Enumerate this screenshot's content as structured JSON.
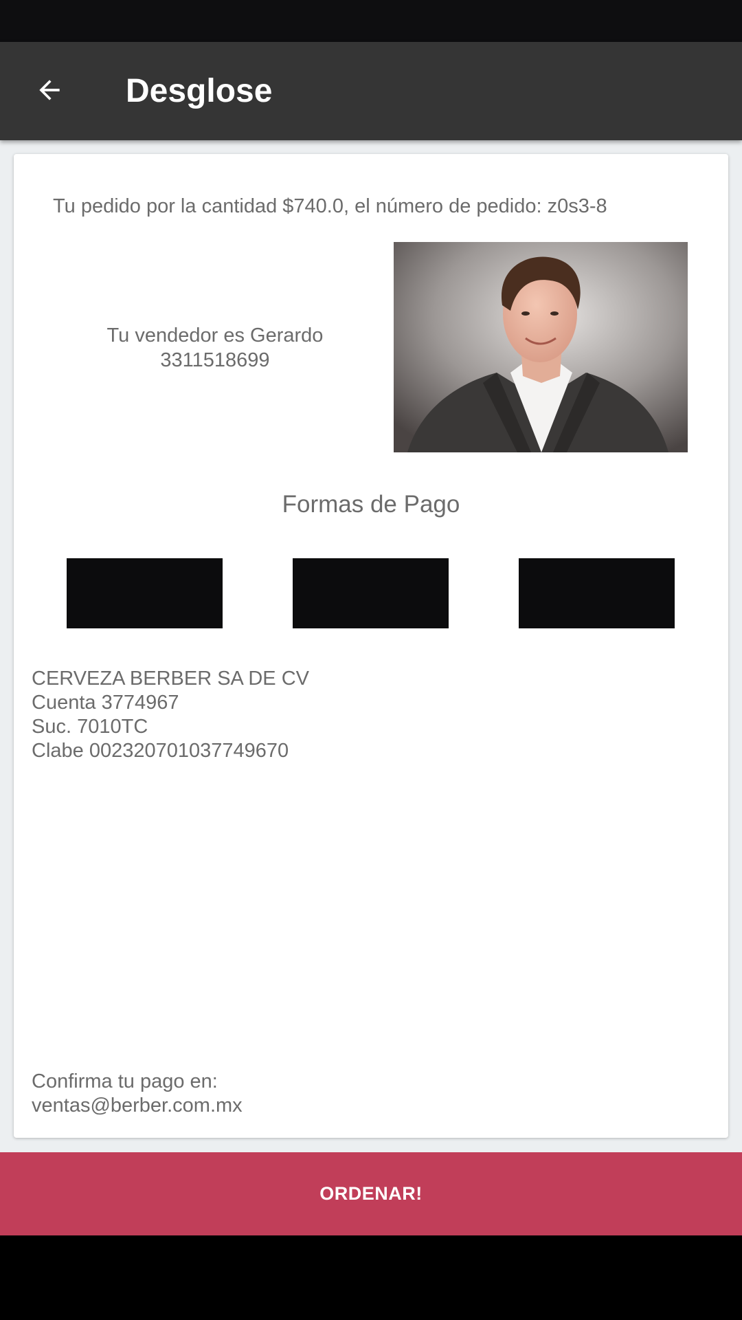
{
  "app_bar": {
    "title": "Desglose",
    "back_icon": "arrow-back-icon"
  },
  "order": {
    "summary": "Tu pedido por la cantidad $740.0, el número de pedido: z0s3-8"
  },
  "vendor": {
    "line1": "Tu vendedor es Gerardo",
    "line2": "3311518699"
  },
  "payment": {
    "title": "Formas de Pago",
    "methods_count": 3
  },
  "bank": {
    "line1": "CERVEZA BERBER SA DE CV",
    "line2": "Cuenta 3774967",
    "line3": "Suc. 7010TC",
    "line4": "Clabe 002320701037749670"
  },
  "confirm": {
    "line1": "Confirma tu pago en:",
    "line2": "ventas@berber.com.mx"
  },
  "actions": {
    "order_label": "ORDENAR!"
  },
  "colors": {
    "app_bar": "#353535",
    "accent": "#c13e59",
    "text": "#6b6b6b"
  }
}
